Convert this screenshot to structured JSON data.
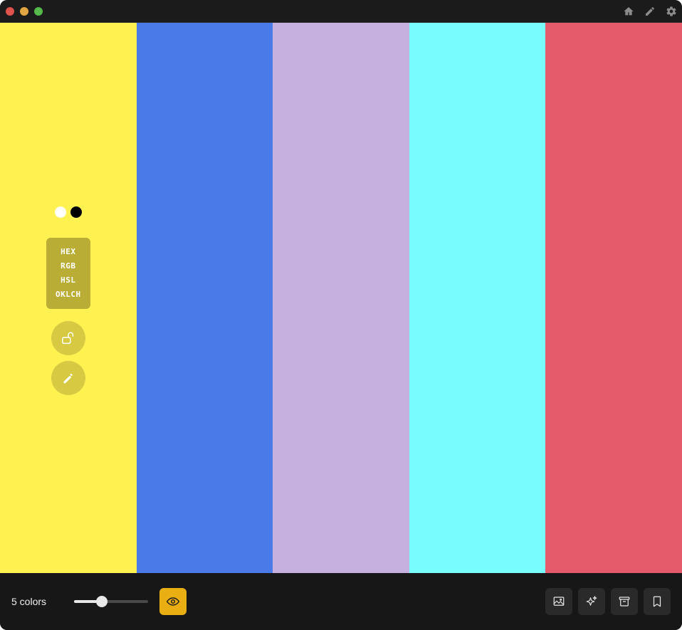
{
  "window": {
    "traffic_colors": {
      "close": "#e0534d",
      "minimize": "#e0a641",
      "maximize": "#54b94a"
    },
    "title_icons": [
      "home-icon",
      "pencil-icon",
      "gear-icon"
    ]
  },
  "palette": {
    "swatches": [
      {
        "color": "#fff150"
      },
      {
        "color": "#4a7ae8"
      },
      {
        "color": "#c5b0e0"
      },
      {
        "color": "#78fcfc"
      },
      {
        "color": "#e55b6b"
      }
    ],
    "active_swatch_index": 0,
    "contrast_dots": [
      "#ffffff",
      "#000000"
    ],
    "formats": [
      "HEX",
      "RGB",
      "HSL",
      "OKLCH"
    ],
    "lock_icon": "unlock-icon",
    "edit_icon": "pencil-icon"
  },
  "toolbar": {
    "count_label": "5 colors",
    "slider": {
      "value": 5,
      "min": 2,
      "max": 10
    },
    "preview_icon": "eye-icon",
    "accent_color": "#e8ae12",
    "actions": [
      "image-icon",
      "sparkle-icon",
      "archive-icon",
      "bookmark-icon"
    ]
  }
}
